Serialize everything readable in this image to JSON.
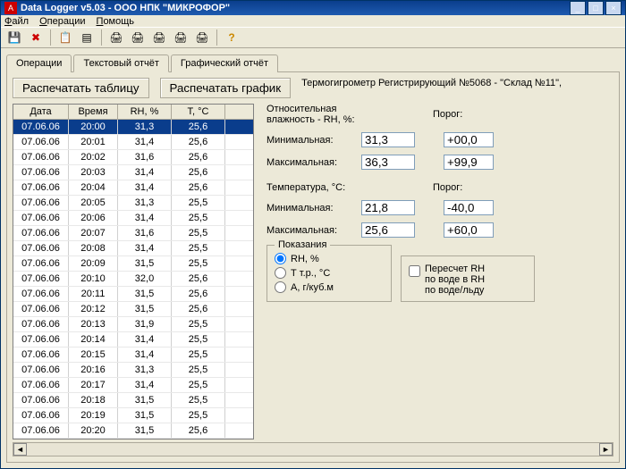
{
  "window": {
    "title": "Data Logger v5.03  -  ООО НПК \"МИКРОФОР\"",
    "app_icon": "A"
  },
  "menu": {
    "file": "Файл",
    "operations": "Операции",
    "help": "Помощь"
  },
  "tabs": {
    "ops": "Операции",
    "text_report": "Текстовый отчёт",
    "graph_report": "Графический отчёт"
  },
  "buttons": {
    "print_table": "Распечатать таблицу",
    "print_chart": "Распечатать график"
  },
  "device_info": "Термогигрометр Регистрирующий №5068 - \"Склад №11\",",
  "labels": {
    "rh_header": "Относительная\nвлажность - RH, %:",
    "threshold": "Порог:",
    "min": "Минимальная:",
    "max": "Максимальная:",
    "temp_header": "Температура, °C:",
    "readings": "Показания",
    "recalc_title": "Пересчет RH\nпо воде в RH\nпо воде/льду"
  },
  "values": {
    "rh_min": "31,3",
    "rh_min_thresh": "+00,0",
    "rh_max": "36,3",
    "rh_max_thresh": "+99,9",
    "t_min": "21,8",
    "t_min_thresh": "-40,0",
    "t_max": "25,6",
    "t_max_thresh": "+60,0"
  },
  "readings_radio": {
    "rh": "RH, %",
    "dew": "Т т.р., °C",
    "abs": "A, г/куб.м"
  },
  "table": {
    "headers": [
      "Дата",
      "Время",
      "RH, %",
      "T, °C"
    ],
    "rows": [
      [
        "07.06.06",
        "20:00",
        "31,3",
        "25,6"
      ],
      [
        "07.06.06",
        "20:01",
        "31,4",
        "25,6"
      ],
      [
        "07.06.06",
        "20:02",
        "31,6",
        "25,6"
      ],
      [
        "07.06.06",
        "20:03",
        "31,4",
        "25,6"
      ],
      [
        "07.06.06",
        "20:04",
        "31,4",
        "25,6"
      ],
      [
        "07.06.06",
        "20:05",
        "31,3",
        "25,5"
      ],
      [
        "07.06.06",
        "20:06",
        "31,4",
        "25,5"
      ],
      [
        "07.06.06",
        "20:07",
        "31,6",
        "25,5"
      ],
      [
        "07.06.06",
        "20:08",
        "31,4",
        "25,5"
      ],
      [
        "07.06.06",
        "20:09",
        "31,5",
        "25,5"
      ],
      [
        "07.06.06",
        "20:10",
        "32,0",
        "25,6"
      ],
      [
        "07.06.06",
        "20:11",
        "31,5",
        "25,6"
      ],
      [
        "07.06.06",
        "20:12",
        "31,5",
        "25,6"
      ],
      [
        "07.06.06",
        "20:13",
        "31,9",
        "25,5"
      ],
      [
        "07.06.06",
        "20:14",
        "31,4",
        "25,5"
      ],
      [
        "07.06.06",
        "20:15",
        "31,4",
        "25,5"
      ],
      [
        "07.06.06",
        "20:16",
        "31,3",
        "25,5"
      ],
      [
        "07.06.06",
        "20:17",
        "31,4",
        "25,5"
      ],
      [
        "07.06.06",
        "20:18",
        "31,5",
        "25,5"
      ],
      [
        "07.06.06",
        "20:19",
        "31,5",
        "25,5"
      ],
      [
        "07.06.06",
        "20:20",
        "31,5",
        "25,6"
      ]
    ]
  }
}
